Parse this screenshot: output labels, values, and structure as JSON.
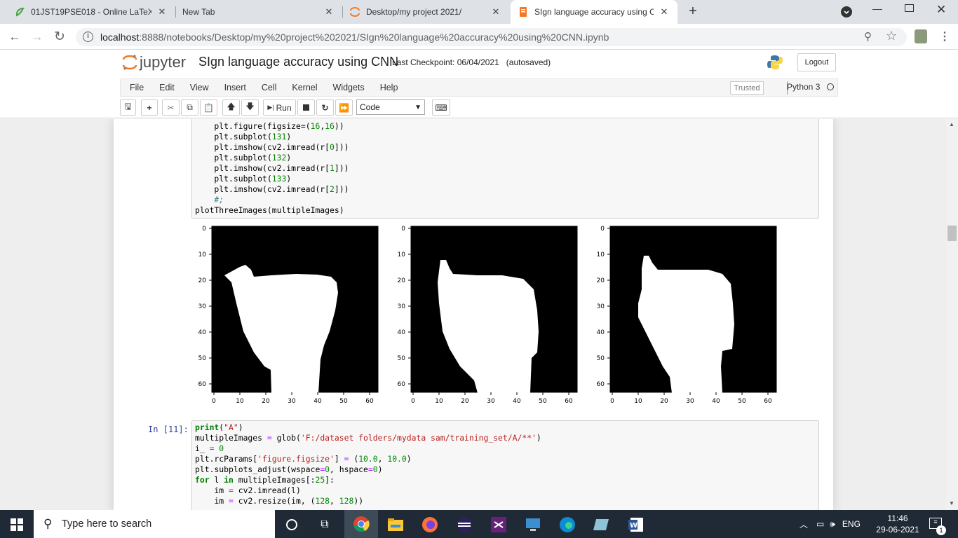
{
  "browser": {
    "tabs": [
      {
        "title": "01JST19PSE018 - Online LaTeX Ec",
        "icon": "overleaf-icon"
      },
      {
        "title": "New Tab",
        "icon": ""
      },
      {
        "title": "Desktop/my project 2021/",
        "icon": "jupyter-icon"
      },
      {
        "title": "SIgn language accuracy using CN",
        "icon": "jupyter-notebook-icon"
      }
    ],
    "url_host": "localhost",
    "url_path": ":8888/notebooks/Desktop/my%20project%202021/SIgn%20language%20accuracy%20using%20CNN.ipynb"
  },
  "jupyter": {
    "logo_text": "jupyter",
    "notebook_title": "SIgn language accuracy using CNN",
    "checkpoint": "Last Checkpoint: 06/04/2021",
    "autosaved": "(autosaved)",
    "logout_label": "Logout",
    "menu": [
      "File",
      "Edit",
      "View",
      "Insert",
      "Cell",
      "Kernel",
      "Widgets",
      "Help"
    ],
    "trusted_label": "Trusted",
    "kernel_name": "Python 3",
    "run_label": "Run",
    "cell_type": "Code"
  },
  "cell1": {
    "lines": [
      "    plt.figure(figsize=(16,16))",
      "    plt.subplot(131)",
      "    plt.imshow(cv2.imread(r[0]))",
      "    plt.subplot(132)",
      "    plt.imshow(cv2.imread(r[1]))",
      "    plt.subplot(133)",
      "    plt.imshow(cv2.imread(r[2]))",
      "    #;",
      "plotThreeImages(multipleImages)"
    ]
  },
  "output_plots": {
    "ticks": [
      "0",
      "10",
      "20",
      "30",
      "40",
      "50",
      "60"
    ],
    "panel_count": 3
  },
  "cell2": {
    "prompt": "In [11]:",
    "lines": [
      "print(\"A\")",
      "multipleImages = glob('F:/dataset folders/mydata sam/training_set/A/**')",
      "i_ = 0",
      "plt.rcParams['figure.figsize'] = (10.0, 10.0)",
      "plt.subplots_adjust(wspace=0, hspace=0)",
      "for l in multipleImages[:25]:",
      "    im = cv2.imread(l)",
      "    im = cv2.resize(im, (128, 128))"
    ]
  },
  "taskbar": {
    "search_placeholder": "Type here to search",
    "language": "ENG",
    "time": "11:46",
    "date": "29-06-2021",
    "notification_count": "1"
  }
}
